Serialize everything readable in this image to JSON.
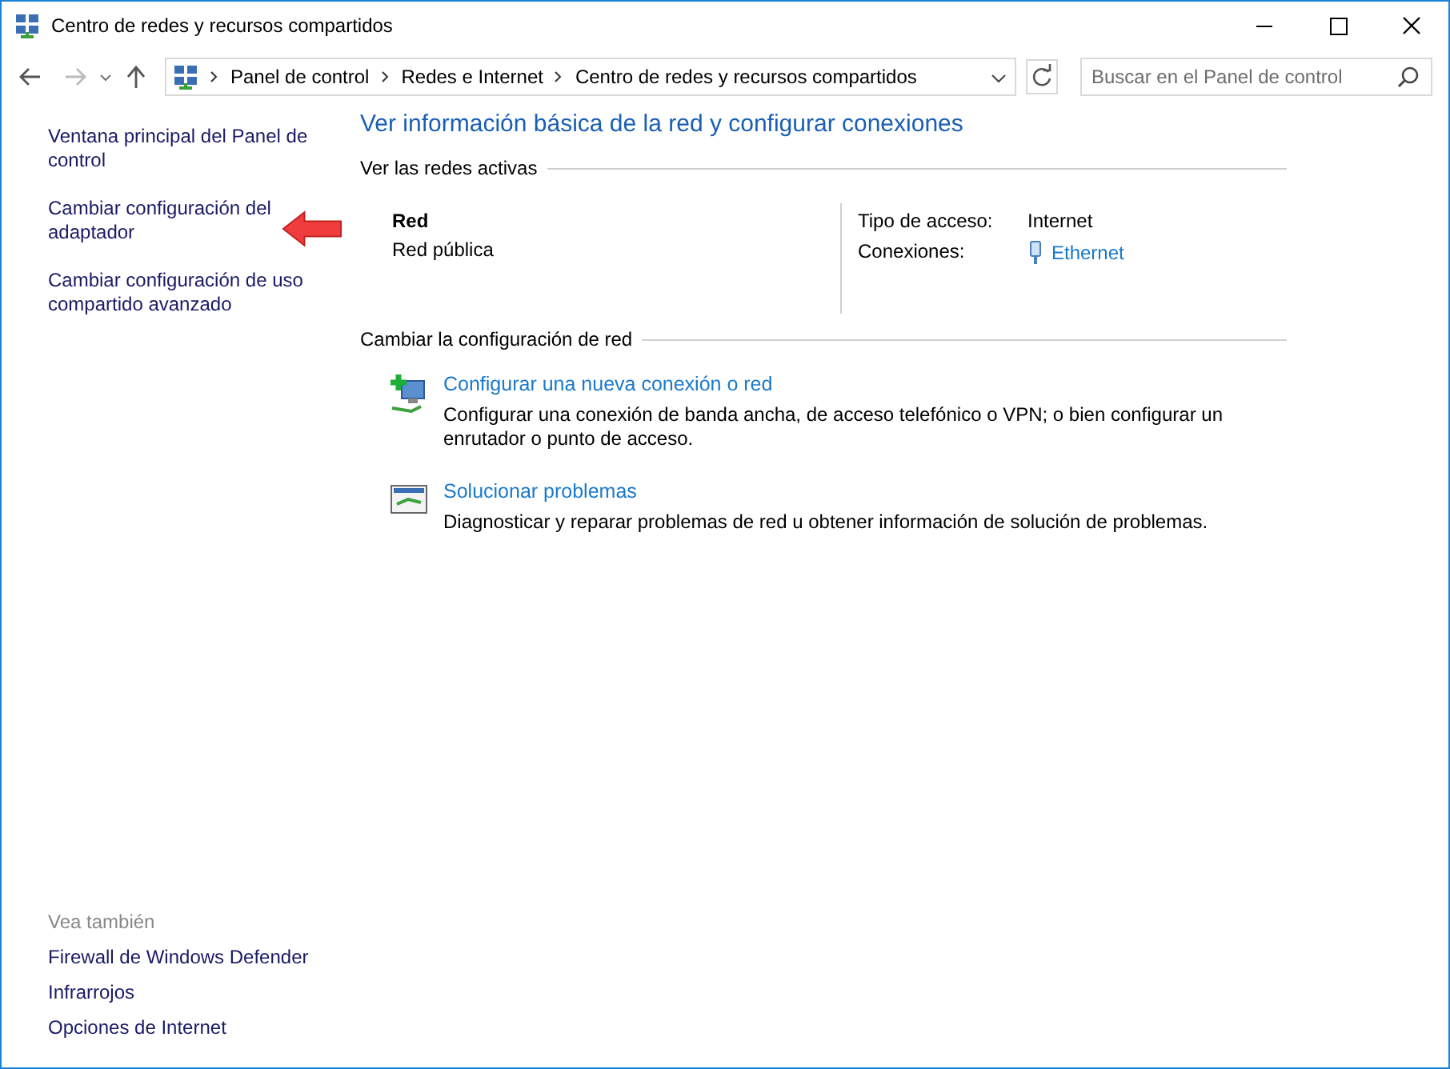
{
  "window": {
    "title": "Centro de redes y recursos compartidos"
  },
  "address_bar": {
    "breadcrumbs": [
      "Panel de control",
      "Redes e Internet",
      "Centro de redes y recursos compartidos"
    ],
    "search_placeholder": "Buscar en el Panel de control"
  },
  "sidebar": {
    "links": [
      "Ventana principal del Panel de control",
      "Cambiar configuración del adaptador",
      "Cambiar configuración de uso compartido avanzado"
    ],
    "see_also": {
      "heading": "Vea también",
      "links": [
        "Firewall de Windows Defender",
        "Infrarrojos",
        "Opciones de Internet"
      ]
    }
  },
  "main": {
    "title": "Ver información básica de la red y configurar conexiones",
    "active_networks": {
      "heading": "Ver las redes activas",
      "network_name": "Red",
      "network_type": "Red pública",
      "properties": [
        {
          "label": "Tipo de acceso:",
          "value": "Internet",
          "kind": "text"
        },
        {
          "label": "Conexiones:",
          "value": "Ethernet",
          "kind": "link"
        }
      ]
    },
    "change_settings": {
      "heading": "Cambiar la configuración de red",
      "tasks": [
        {
          "kind": "new-connection",
          "title": "Configurar una nueva conexión o red",
          "description": "Configurar una conexión de banda ancha, de acceso telefónico o VPN; o bien configurar un enrutador o punto de acceso."
        },
        {
          "kind": "troubleshoot",
          "title": "Solucionar problemas",
          "description": "Diagnosticar y reparar problemas de red u obtener información de solución de problemas."
        }
      ]
    }
  }
}
